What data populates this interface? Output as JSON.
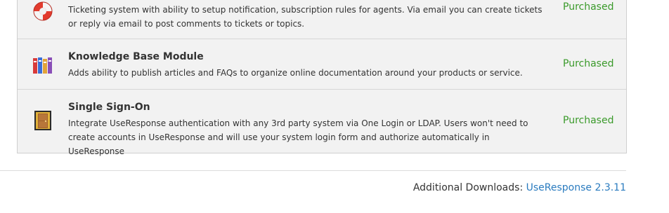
{
  "modules": [
    {
      "icon": "lifebuoy-icon",
      "title": "",
      "description": "Ticketing system with ability to setup notification, subscription rules for agents. Via email you can create tickets or reply via email to post comments to tickets or topics.",
      "status": "Purchased"
    },
    {
      "icon": "books-icon",
      "title": "Knowledge Base Module",
      "description": "Adds ability to publish articles and FAQs to organize online documentation around your products or service.",
      "status": "Purchased"
    },
    {
      "icon": "door-icon",
      "title": "Single Sign-On",
      "description": "Integrate UseResponse authentication with any 3rd party system via One Login or LDAP. Users won't need to create accounts in UseResponse and will use your system login form and authorize automatically in UseResponse",
      "status": "Purchased"
    }
  ],
  "footer": {
    "label": "Additional Downloads:",
    "link_text": "UseResponse 2.3.11"
  },
  "colors": {
    "status_green": "#3a9a2a",
    "link_blue": "#2a7bbf",
    "panel_bg": "#f2f2f2"
  }
}
